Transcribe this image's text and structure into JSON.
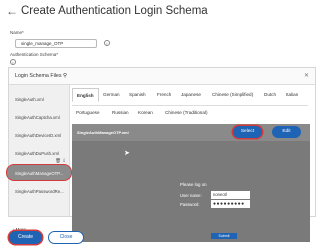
{
  "header": {
    "back_icon": "back-arrow-icon",
    "title": "Create Authentication Login Schema"
  },
  "form": {
    "name_label": "Name*",
    "name_value": "single_manage_OTP",
    "info_icon": "info-icon",
    "schema_label": "Authentication Schema*"
  },
  "panel": {
    "title": "Login Schema Files",
    "search_icon": "search-icon",
    "close_icon": "close-icon",
    "files": [
      {
        "label": "SingleAuth.xml"
      },
      {
        "label": "SingleAuthCaptcha.xml"
      },
      {
        "label": "SingleAuthDeviceID.xml"
      },
      {
        "label": "SingleAuthDuPush.xml"
      },
      {
        "label": "SingleAuthManageOTP..."
      },
      {
        "label": "SingleAuthPasswordRe..."
      }
    ],
    "more_label": "More",
    "tabs_row1": [
      "English",
      "German",
      "Spanish",
      "French",
      "Japanese",
      "Chinese (Simplified)",
      "Dutch",
      "Italian"
    ],
    "tabs_row2": [
      "Portuguese",
      "Russian",
      "Korean",
      "Chinese (Traditional)"
    ],
    "selected_file": "SingleAuthManageOTP.xml",
    "select_label": "Select",
    "edit_label": "Edit",
    "preview": {
      "logon": "Please log on",
      "username_label": "User name:",
      "username_value": "noneotl",
      "password_label": "Password:",
      "password_value": "●●●●●●●●●",
      "submit_label": "Submit"
    }
  },
  "footer": {
    "create_label": "Create",
    "close_label": "Close"
  }
}
